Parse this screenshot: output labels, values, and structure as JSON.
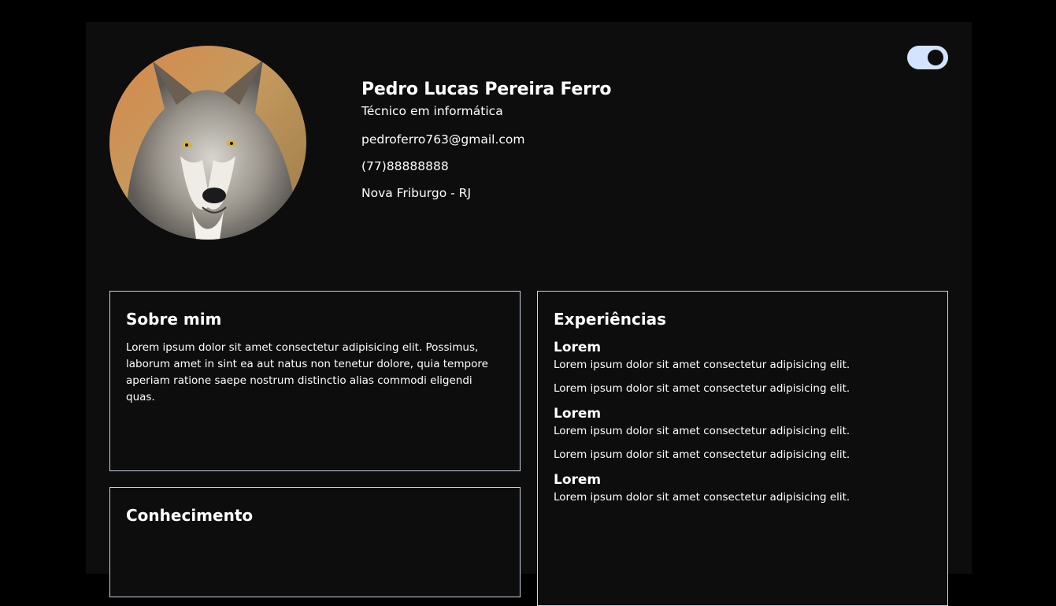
{
  "profile": {
    "name": "Pedro Lucas Pereira Ferro",
    "role": "Técnico em informática",
    "email": "pedroferro763@gmail.com",
    "phone": "(77)88888888",
    "location": "Nova Friburgo - RJ"
  },
  "theme_toggle": {
    "state": "on",
    "track_color": "#d2e4ff",
    "knob_color": "#0d0d0e"
  },
  "about": {
    "title": "Sobre mim",
    "text": "Lorem ipsum dolor sit amet consectetur adipisicing elit. Possimus, laborum amet in sint ea aut natus non tenetur dolore, quia tempore aperiam ratione saepe nostrum distinctio alias commodi eligendi quas."
  },
  "knowledge": {
    "title": "Conhecimento"
  },
  "experience": {
    "title": "Experiências",
    "items": [
      {
        "title": "Lorem",
        "line1": "Lorem ipsum dolor sit amet consectetur adipisicing elit.",
        "line2": "Lorem ipsum dolor sit amet consectetur adipisicing elit."
      },
      {
        "title": "Lorem",
        "line1": "Lorem ipsum dolor sit amet consectetur adipisicing elit.",
        "line2": "Lorem ipsum dolor sit amet consectetur adipisicing elit."
      },
      {
        "title": "Lorem",
        "line1": "Lorem ipsum dolor sit amet consectetur adipisicing elit.",
        "line2": ""
      }
    ]
  },
  "colors": {
    "background": "#000000",
    "panel": "#0d0d0e",
    "border": "#c9d3e0",
    "text": "#ffffff"
  }
}
